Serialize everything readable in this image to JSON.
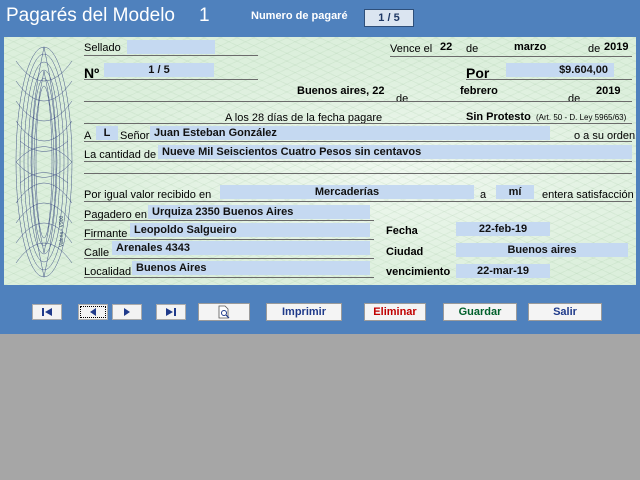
{
  "header": {
    "title": "Pagarés del Modelo",
    "model_number": "1",
    "note_label": "Numero de pagaré",
    "note_value": "1 / 5"
  },
  "check": {
    "sellado_label": "Sellado",
    "sellado_value": "",
    "vence_label": "Vence el",
    "vence_day": "22",
    "de1": "de",
    "vence_month": "marzo",
    "de2": "de",
    "vence_year": "2019",
    "no_label": "Nº",
    "no_value": "1 / 5",
    "por_label": "Por",
    "amount": "$9.604,00",
    "place_date": "Buenos aires,  22",
    "de3": "de",
    "issue_month": "febrero",
    "de4": "de",
    "issue_year": "2019",
    "days_text": "A los 28 días de la fecha pagare",
    "sin_protesto": "Sin Protesto",
    "ley_text": "(Art. 50 - D. Ley 5965/63)",
    "a_label": "A",
    "a_value": "L",
    "senor_label": "Señor",
    "payee": "Juan Esteban  González",
    "orden_text": "o a su orden",
    "cantidad_label": "La cantidad de",
    "amount_words": "Nueve Mil Seiscientos Cuatro Pesos sin centavos",
    "valor_label": "Por igual valor recibido en",
    "valor_value": "Mercaderías",
    "a2": "a",
    "mi_value": "mí",
    "satisfaccion": "entera satisfacción",
    "pagadero_label": "Pagadero en",
    "pagadero_value": "Urquiza 2350 Buenos Aires",
    "firmante_label": "Firmante",
    "firmante_value": "Leopoldo Salgueiro",
    "fecha_label": "Fecha",
    "fecha_value": "22-feb-19",
    "calle_label": "Calle",
    "calle_value": "Arenales 4343",
    "ciudad_label": "Ciudad",
    "ciudad_value": "Buenos aires",
    "localidad_label": "Localidad",
    "localidad_value": "Buenos Aires",
    "vencimiento_label": "vencimiento",
    "vencimiento_value": "22-mar-19",
    "serial": "Valeria - V900"
  },
  "toolbar": {
    "imprimir": "Imprimir",
    "eliminar": "Eliminar",
    "guardar": "Guardar",
    "salir": "Salir"
  },
  "colors": {
    "header_bg": "#4f81bd",
    "field_bg": "#c5d9f1",
    "eliminar": "#c00000",
    "guardar": "#00602b",
    "imprimir": "#1f3a8a",
    "salir": "#1f3a8a"
  },
  "icons": {
    "first": "first-record-icon",
    "prev": "previous-record-icon",
    "next": "next-record-icon",
    "last": "last-record-icon",
    "preview": "print-preview-icon"
  }
}
